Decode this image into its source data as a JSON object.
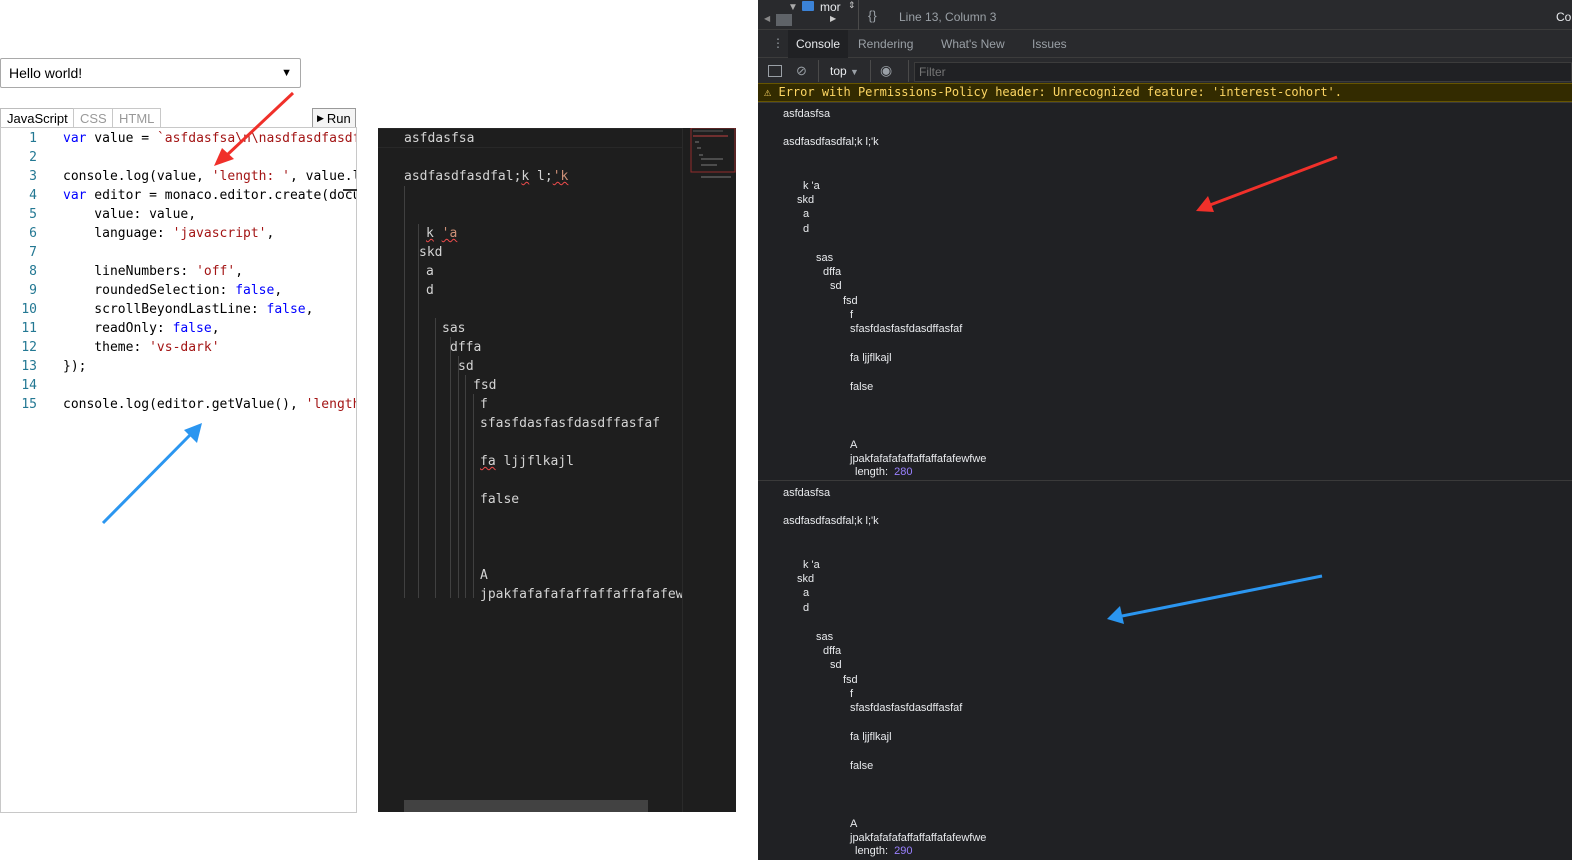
{
  "playground": {
    "sample_select": "Hello world!",
    "tabs": [
      "JavaScript",
      "CSS",
      "HTML"
    ],
    "run_label": "Run"
  },
  "code": {
    "lines": [
      {
        "n": "1",
        "html": "<span class='kw'>var</span> value = <span class='str'>`asfdasfsa\\n\\nasdfasdfasdfa</span>"
      },
      {
        "n": "2",
        "html": ""
      },
      {
        "n": "3",
        "html": "console.log(value, <span class='str'>'length: '</span>, value.le"
      },
      {
        "n": "4",
        "html": "<span class='kw'>var</span> editor = monaco.editor.create(docum"
      },
      {
        "n": "5",
        "html": "    value: value,"
      },
      {
        "n": "6",
        "html": "    language: <span class='str'>'javascript'</span>,"
      },
      {
        "n": "7",
        "html": ""
      },
      {
        "n": "8",
        "html": "    lineNumbers: <span class='str'>'off'</span>,"
      },
      {
        "n": "9",
        "html": "    roundedSelection: <span class='lit'>false</span>,"
      },
      {
        "n": "10",
        "html": "    scrollBeyondLastLine: <span class='lit'>false</span>,"
      },
      {
        "n": "11",
        "html": "    readOnly: <span class='lit'>false</span>,"
      },
      {
        "n": "12",
        "html": "    theme: <span class='str'>'vs-dark'</span>"
      },
      {
        "n": "13",
        "html": "});"
      },
      {
        "n": "14",
        "html": ""
      },
      {
        "n": "15",
        "html": "console.log(editor.getValue(), <span class='str'>'length</span>"
      }
    ]
  },
  "dark_editor": {
    "lines": [
      "asfdasfsa",
      "asdfasdfasdfal;k l;'k",
      "k 'a",
      "skd",
      "a",
      "d",
      "sas",
      "dffa",
      "sd",
      "fsd",
      "f",
      "sfasfdasfasfdasdffasfaf",
      "fa ljjflkajl",
      "false",
      "A",
      "jpakfafafafaffaffaffafafewf"
    ]
  },
  "devtools": {
    "source_tab": "mor",
    "cursor_position": "Line 13, Column 3",
    "right_edge_text": "Co",
    "tabs": [
      "Console",
      "Rendering",
      "What's New",
      "Issues"
    ],
    "context": "top",
    "filter_placeholder": "Filter",
    "warning": "Error with Permissions-Policy header: Unrecognized feature: 'interest-cohort'.",
    "log_lines": [
      "asfdasfsa",
      "asdfasdfasdfal;k l;'k",
      "k 'a",
      "skd",
      "a",
      "d",
      "sas",
      "dffa",
      "sd",
      "fsd",
      "f",
      "sfasfdasfasfdasdffasfaf",
      "fa ljjflkajl",
      "false",
      "A",
      "jpakfafafafaffaffaffafafewfwe"
    ],
    "length_label": "length:",
    "length_values": [
      "280",
      "290"
    ]
  },
  "colors": {
    "arrow_red": "#f0302a",
    "arrow_blue": "#2b96f0",
    "devtools_bg": "#202124",
    "editor_dark_bg": "#1e1e1e"
  }
}
